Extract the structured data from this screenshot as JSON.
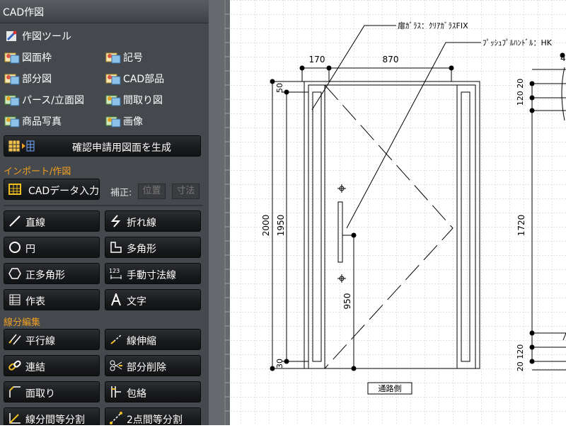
{
  "panel": {
    "title": "CAD作図",
    "tree": [
      {
        "label": "作図ツール",
        "icon": "tools-icon"
      },
      {
        "label": "図面枠",
        "icon": "frame-icon"
      },
      {
        "label": "記号",
        "icon": "symbol-icon"
      },
      {
        "label": "部分図",
        "icon": "partial-icon"
      },
      {
        "label": "CAD部品",
        "icon": "cad-parts-icon"
      },
      {
        "label": "パース/立面図",
        "icon": "perspective-icon"
      },
      {
        "label": "間取り図",
        "icon": "floorplan-icon"
      },
      {
        "label": "商品写真",
        "icon": "photo-icon"
      },
      {
        "label": "画像",
        "icon": "image-icon"
      }
    ],
    "generate_button": "確認申請用図面を生成",
    "import_section": "インポート/作図",
    "cad_input_button": "CADデータ入力",
    "correction_label": "補正:",
    "position_button": "位置",
    "dimension_button": "寸法",
    "draw_tools": [
      {
        "label": "直線",
        "icon": "line-icon"
      },
      {
        "label": "折れ線",
        "icon": "polyline-icon"
      },
      {
        "label": "円",
        "icon": "circle-icon"
      },
      {
        "label": "多角形",
        "icon": "polygon-icon"
      },
      {
        "label": "正多角形",
        "icon": "regular-polygon-icon"
      },
      {
        "label": "手動寸法線",
        "icon": "manual-dimension-icon"
      },
      {
        "label": "作表",
        "icon": "table-icon"
      },
      {
        "label": "文字",
        "icon": "text-icon"
      }
    ],
    "edit_section": "線分編集",
    "edit_tools": [
      {
        "label": "平行線",
        "icon": "parallel-line-icon"
      },
      {
        "label": "線伸縮",
        "icon": "line-stretch-icon"
      },
      {
        "label": "連結",
        "icon": "link-icon"
      },
      {
        "label": "部分削除",
        "icon": "partial-delete-icon"
      },
      {
        "label": "面取り",
        "icon": "chamfer-icon"
      },
      {
        "label": "包絡",
        "icon": "envelope-icon"
      },
      {
        "label": "線分間等分割",
        "icon": "segment-divide-icon"
      },
      {
        "label": "2点間等分割",
        "icon": "two-point-divide-icon"
      }
    ]
  },
  "drawing": {
    "annotations": {
      "glass": "扉ｶﾞﾗｽ：ｸﾘｱｶﾞﾗｽFIX",
      "handle": "ﾌﾟｯｼｭﾌﾟﾙﾊﾝﾄﾞﾙ：HK"
    },
    "dims_main": {
      "top_left": "170",
      "top_right": "870",
      "side_50": "50",
      "side_2000": "2000",
      "side_1950": "1950",
      "side_30": "30",
      "handle_950": "950"
    },
    "dims_right": {
      "top_4": "4",
      "r_120_20_top": "120 20",
      "r_1720": "1720",
      "r_20_120_bottom": "20 120"
    },
    "street_label": "通路側"
  }
}
